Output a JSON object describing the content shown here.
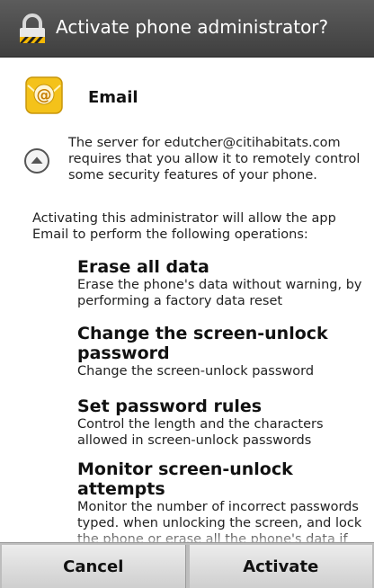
{
  "dialog": {
    "title": "Activate phone administrator?"
  },
  "app": {
    "name": "Email",
    "server_note": "The server for edutcher@citihabitats.com requires that you allow it to remotely control some security features of your phone."
  },
  "intro": "Activating this administrator will allow the app Email to perform the following operations:",
  "permissions": [
    {
      "title": "Erase all data",
      "desc": "Erase the phone's data without warning, by performing a factory data reset"
    },
    {
      "title": "Change the screen-unlock password",
      "desc": "Change the screen-unlock password"
    },
    {
      "title": "Set password rules",
      "desc": "Control the length and the characters allowed in screen-unlock passwords"
    },
    {
      "title": "Monitor screen-unlock attempts",
      "desc": "Monitor the number of incorrect passwords typed. when unlocking the screen, and lock the phone or erase all the phone's data if too many incorrect"
    }
  ],
  "buttons": {
    "cancel": "Cancel",
    "activate": "Activate"
  },
  "colors": {
    "titlebar": "#4a4a4a",
    "email_icon_yellow": "#f4c21a",
    "button_bg": "#dcdcdc"
  }
}
